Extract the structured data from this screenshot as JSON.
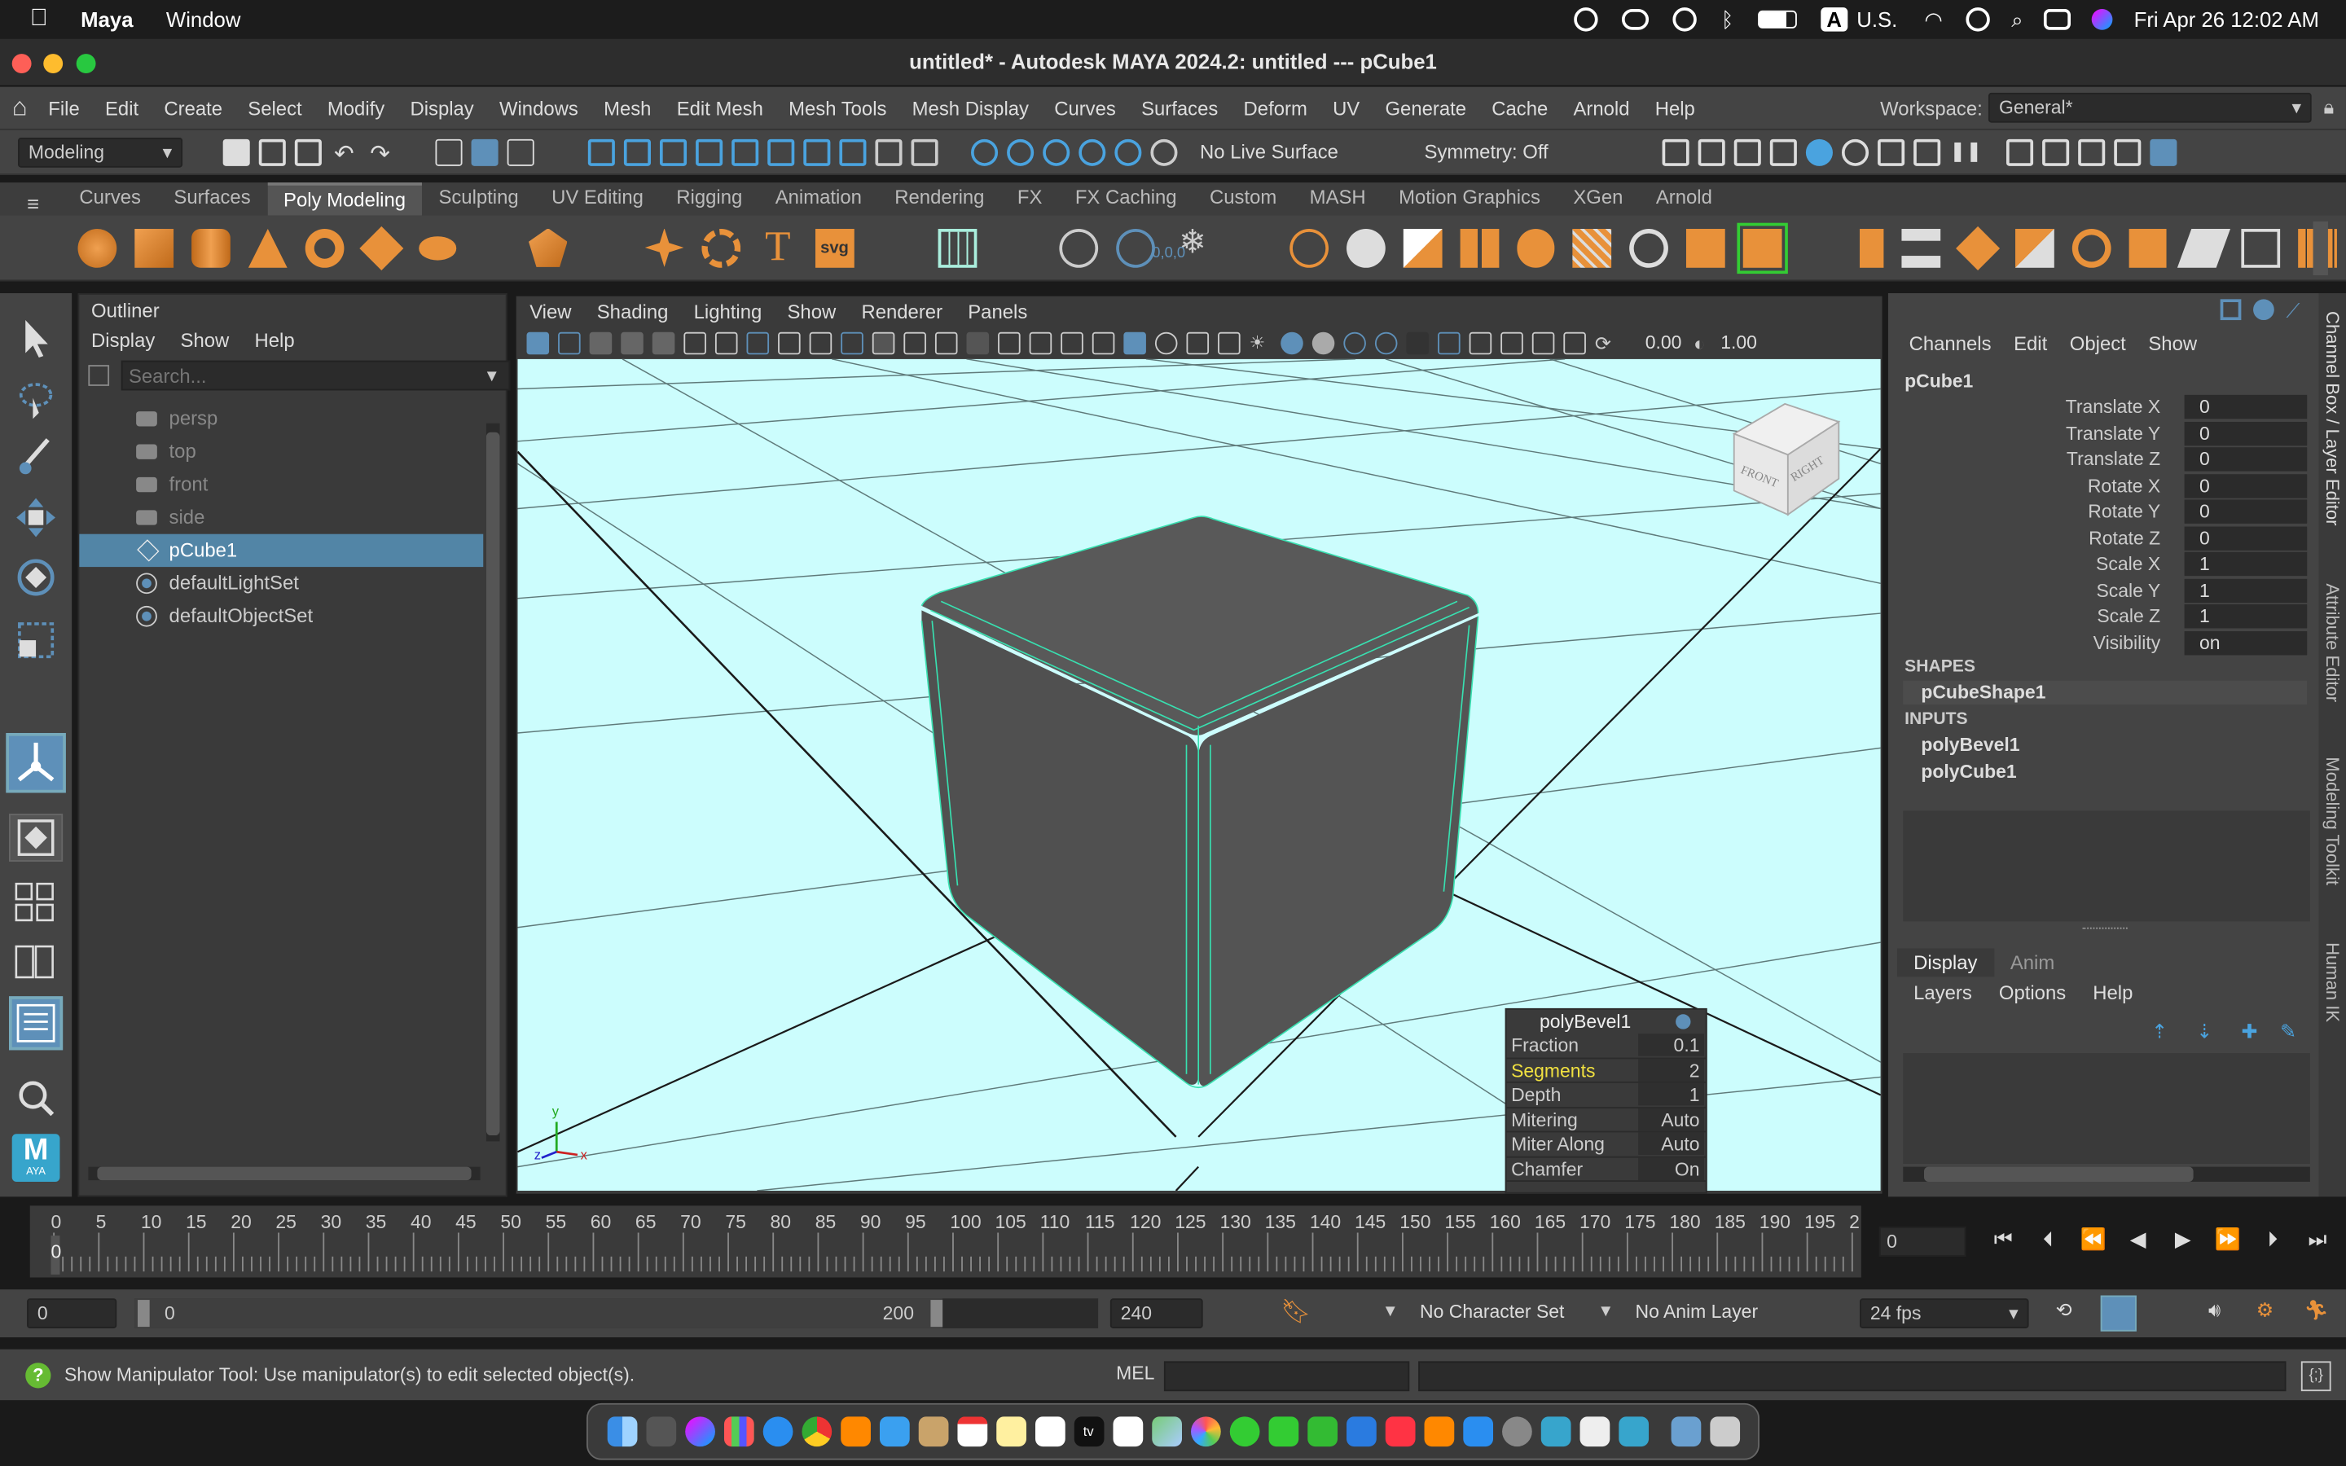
{
  "mac": {
    "app": "Maya",
    "menu": "Window",
    "time": "Fri Apr 26  12:02 AM",
    "keyboard": "U.S.",
    "input_badge": "A"
  },
  "window": {
    "title": "untitled* - Autodesk MAYA 2024.2: untitled   ---   pCube1"
  },
  "menus": [
    "File",
    "Edit",
    "Create",
    "Select",
    "Modify",
    "Display",
    "Windows",
    "Mesh",
    "Edit Mesh",
    "Mesh Tools",
    "Mesh Display",
    "Curves",
    "Surfaces",
    "Deform",
    "UV",
    "Generate",
    "Cache",
    "Arnold",
    "Help"
  ],
  "workspace": {
    "label": "Workspace:",
    "value": "General*"
  },
  "status": {
    "mode": "Modeling",
    "live_surface": "No Live Surface",
    "symmetry": "Symmetry: Off"
  },
  "shelf_tabs": [
    "Curves",
    "Surfaces",
    "Poly Modeling",
    "Sculpting",
    "UV Editing",
    "Rigging",
    "Animation",
    "Rendering",
    "FX",
    "FX Caching",
    "Custom",
    "MASH",
    "Motion Graphics",
    "XGen",
    "Arnold"
  ],
  "shelf_active": "Poly Modeling",
  "shelf_text": {
    "svg": "svg",
    "coords": "0,0,0"
  },
  "outliner": {
    "title": "Outliner",
    "menus": [
      "Display",
      "Show",
      "Help"
    ],
    "search_placeholder": "Search...",
    "items": [
      {
        "label": "persp",
        "icon": "camera-icon",
        "dim": true
      },
      {
        "label": "top",
        "icon": "camera-icon",
        "dim": true
      },
      {
        "label": "front",
        "icon": "camera-icon",
        "dim": true
      },
      {
        "label": "side",
        "icon": "camera-icon",
        "dim": true
      },
      {
        "label": "pCube1",
        "icon": "mesh-icon",
        "selected": true
      },
      {
        "label": "defaultLightSet",
        "icon": "set-icon"
      },
      {
        "label": "defaultObjectSet",
        "icon": "set-icon"
      }
    ]
  },
  "viewport": {
    "menus": [
      "View",
      "Shading",
      "Lighting",
      "Show",
      "Renderer",
      "Panels"
    ],
    "field1": "0.00",
    "field2": "1.00",
    "viewcube_front": "FRONT",
    "viewcube_right": "RIGHT",
    "axis_y": "y",
    "axis_z": "z",
    "axis_x": "x",
    "bg_color": "#ccfdfd"
  },
  "polybevel": {
    "title": "polyBevel1",
    "rows": [
      {
        "k": "Fraction",
        "v": "0.1"
      },
      {
        "k": "Segments",
        "v": "2"
      },
      {
        "k": "Depth",
        "v": "1"
      },
      {
        "k": "Mitering",
        "v": "Auto"
      },
      {
        "k": "Miter Along",
        "v": "Auto"
      },
      {
        "k": "Chamfer",
        "v": "On"
      }
    ]
  },
  "channelbox": {
    "menus": [
      "Channels",
      "Edit",
      "Object",
      "Show"
    ],
    "object": "pCube1",
    "attrs": [
      {
        "k": "Translate X",
        "v": "0"
      },
      {
        "k": "Translate Y",
        "v": "0"
      },
      {
        "k": "Translate Z",
        "v": "0"
      },
      {
        "k": "Rotate X",
        "v": "0"
      },
      {
        "k": "Rotate Y",
        "v": "0"
      },
      {
        "k": "Rotate Z",
        "v": "0"
      },
      {
        "k": "Scale X",
        "v": "1"
      },
      {
        "k": "Scale Y",
        "v": "1"
      },
      {
        "k": "Scale Z",
        "v": "1"
      },
      {
        "k": "Visibility",
        "v": "on"
      }
    ],
    "shapes_label": "SHAPES",
    "shape": "pCubeShape1",
    "inputs_label": "INPUTS",
    "inputs": [
      "polyBevel1",
      "polyCube1"
    ],
    "layer_tabs": [
      "Display",
      "Anim"
    ],
    "layer_menus": [
      "Layers",
      "Options",
      "Help"
    ]
  },
  "side_tabs": [
    "Channel Box / Layer Editor",
    "Attribute Editor",
    "Modeling Toolkit",
    "Human IK"
  ],
  "timeline": {
    "ticks": [
      "0",
      "5",
      "10",
      "15",
      "20",
      "25",
      "30",
      "35",
      "40",
      "45",
      "50",
      "55",
      "60",
      "65",
      "70",
      "75",
      "80",
      "85",
      "90",
      "95",
      "100",
      "105",
      "110",
      "115",
      "120",
      "125",
      "130",
      "135",
      "140",
      "145",
      "150",
      "155",
      "160",
      "165",
      "170",
      "175",
      "180",
      "185",
      "190",
      "195",
      "2"
    ],
    "current": "0",
    "current_field": "0"
  },
  "range": {
    "start": "0",
    "inner_start": "0",
    "inner_end": "200",
    "end": "240",
    "character_set": "No Character Set",
    "anim_layer": "No Anim Layer",
    "fps": "24 fps"
  },
  "cmd": {
    "help": "Show Manipulator Tool: Use manipulator(s) to edit selected object(s).",
    "lang": "MEL"
  },
  "toolbox_logo": "M",
  "toolbox_logo_sub": "AYA"
}
